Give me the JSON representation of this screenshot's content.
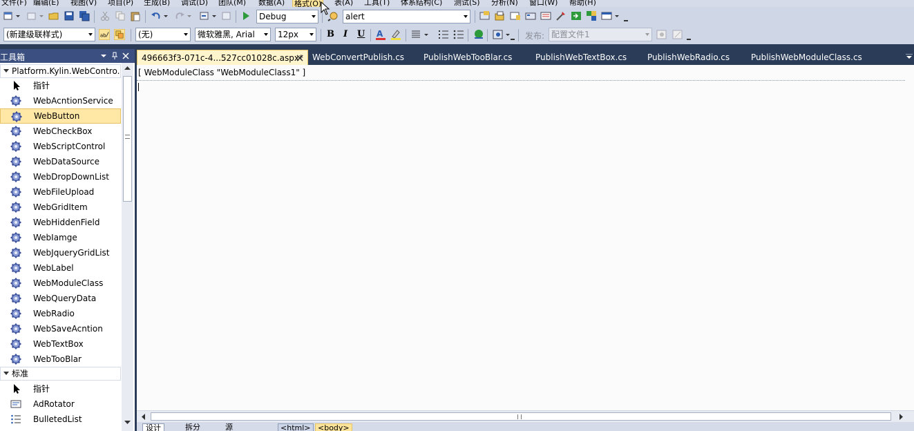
{
  "menu": {
    "items": [
      "文件(F)",
      "编辑(E)",
      "视图(V)",
      "项目(P)",
      "生成(B)",
      "调试(D)",
      "团队(M)",
      "数据(A)",
      "格式(O)",
      "表(A)",
      "工具(T)",
      "体系结构(C)",
      "测试(S)",
      "分析(N)",
      "窗口(W)",
      "帮助(H)"
    ],
    "active_index": 8
  },
  "toolbar1": {
    "config_value": "Debug",
    "find_value": "alert"
  },
  "toolbar2": {
    "style_value": "(新建级联样式)",
    "block_value": "(无)",
    "font_value": "微软雅黑, Arial",
    "size_value": "12px",
    "bold": "B",
    "italic": "I",
    "underline": "U",
    "publish_label": "发布:",
    "publish_value": "配置文件1"
  },
  "toolbox": {
    "title": "工具箱",
    "group1": "Platform.Kylin.WebContro...",
    "items": [
      {
        "label": "指针",
        "icon": "pointer"
      },
      {
        "label": "WebAcntionService",
        "icon": "gear"
      },
      {
        "label": "WebButton",
        "icon": "gear"
      },
      {
        "label": "WebCheckBox",
        "icon": "gear"
      },
      {
        "label": "WebScriptControl",
        "icon": "gear"
      },
      {
        "label": "WebDataSource",
        "icon": "gear"
      },
      {
        "label": "WebDropDownList",
        "icon": "gear"
      },
      {
        "label": "WebFileUpload",
        "icon": "gear"
      },
      {
        "label": "WebGridItem",
        "icon": "gear"
      },
      {
        "label": "WebHiddenField",
        "icon": "gear"
      },
      {
        "label": "WebIamge",
        "icon": "gear"
      },
      {
        "label": "WebJqueryGridList",
        "icon": "gear"
      },
      {
        "label": "WebLabel",
        "icon": "gear"
      },
      {
        "label": "WebModuleClass",
        "icon": "gear"
      },
      {
        "label": "WebQueryData",
        "icon": "gear"
      },
      {
        "label": "WebRadio",
        "icon": "gear"
      },
      {
        "label": "WebSaveAcntion",
        "icon": "gear"
      },
      {
        "label": "WebTextBox",
        "icon": "gear"
      },
      {
        "label": "WebTooBlar",
        "icon": "gear"
      }
    ],
    "selected_index": 2,
    "group2": "标准",
    "items2": [
      {
        "label": "指针",
        "icon": "pointer"
      },
      {
        "label": "AdRotator",
        "icon": "adrotator"
      },
      {
        "label": "BulletedList",
        "icon": "list"
      }
    ]
  },
  "tabs": [
    {
      "label": "496663f3-071c-4...527cc01028c.aspx*",
      "active": true
    },
    {
      "label": "WebConvertPublish.cs",
      "active": false
    },
    {
      "label": "PublishWebTooBlar.cs",
      "active": false
    },
    {
      "label": "PublishWebTextBox.cs",
      "active": false
    },
    {
      "label": "PublishWebRadio.cs",
      "active": false
    },
    {
      "label": "PublishWebModuleClass.cs",
      "active": false
    }
  ],
  "editor": {
    "control_label": "[ WebModuleClass \"WebModuleClass1\" ]"
  },
  "bottom": {
    "design_tab": "设计",
    "split_tab": "拆分",
    "source_tab": "源",
    "crumbs": [
      "<html>",
      "<body>"
    ]
  },
  "colors": {
    "chrome_dark": "#2b3c59",
    "toolbar": "#cfd6e5",
    "highlight": "#ffe8a6",
    "active_tab": "#fff5cc"
  }
}
